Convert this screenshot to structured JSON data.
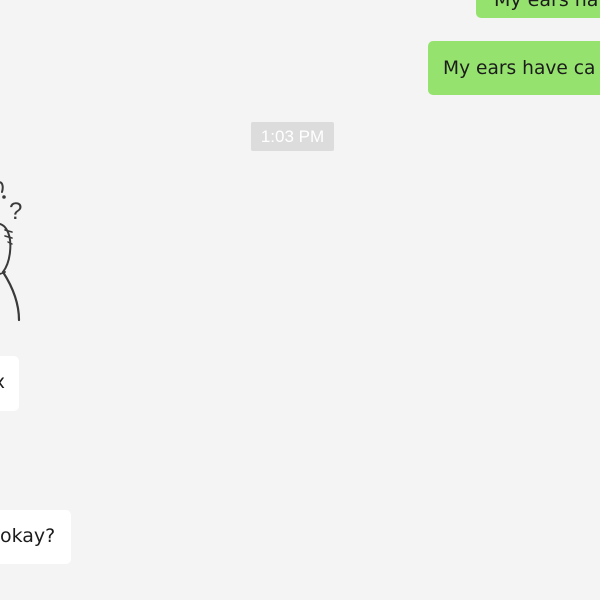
{
  "chat": {
    "timestamp": "1:03 PM",
    "messages": [
      {
        "side": "sent",
        "text": "My ears hav",
        "partially_visible": true
      },
      {
        "side": "sent",
        "text": "My ears have ca",
        "partially_visible": true
      },
      {
        "side": "received",
        "type": "sticker",
        "icon": "confused-cat-sticker-icon",
        "text": "?"
      },
      {
        "side": "received",
        "text": "x",
        "partially_visible": true
      },
      {
        "side": "received",
        "text": "okay?",
        "partially_visible": true
      }
    ]
  },
  "colors": {
    "background": "#f4f4f4",
    "sent_bubble": "#95e36e",
    "received_bubble": "#ffffff",
    "timestamp_chip": "#dcdcdc",
    "timestamp_text": "#ffffff"
  }
}
